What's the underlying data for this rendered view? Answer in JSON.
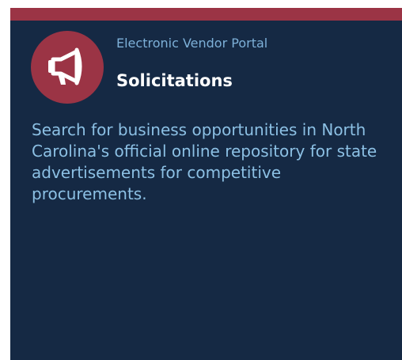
{
  "card": {
    "icon": "megaphone-icon",
    "eyebrow": "Electronic Vendor Portal",
    "title": "Solicitations",
    "description": "Search for business opportunities in North Carolina's official online repository for state advertisements for competitive procurements."
  },
  "colors": {
    "card_background": "#152944",
    "accent": "#9b3445",
    "eyebrow_text": "#7db0d8",
    "title_text": "#ffffff",
    "description_text": "#8cc0e4"
  }
}
